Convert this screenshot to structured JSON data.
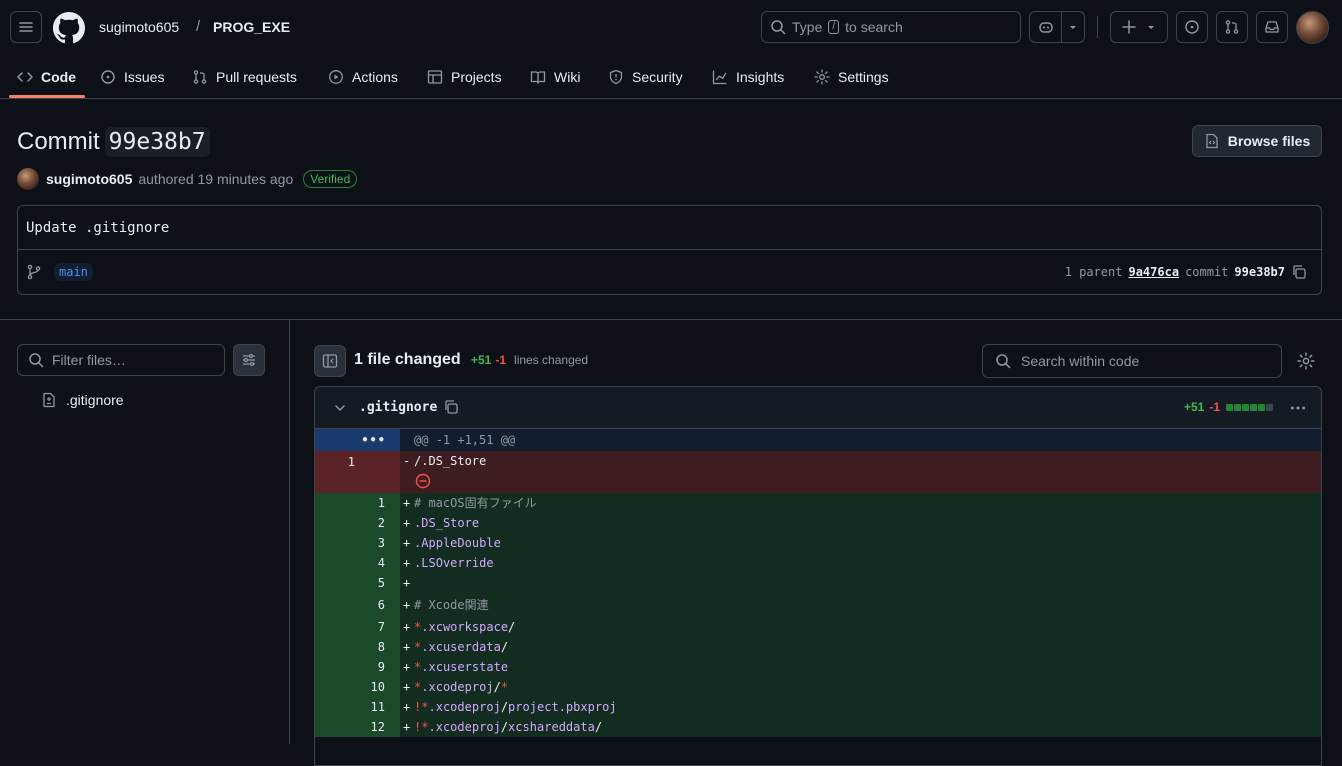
{
  "header": {
    "owner": "sugimoto605",
    "separator": "/",
    "repo": "PROG_EXE",
    "search_prefix": "Type",
    "search_key": "/",
    "search_suffix": "to search"
  },
  "nav": {
    "code": "Code",
    "issues": "Issues",
    "pulls": "Pull requests",
    "actions": "Actions",
    "projects": "Projects",
    "wiki": "Wiki",
    "security": "Security",
    "insights": "Insights",
    "settings": "Settings"
  },
  "commit": {
    "title_prefix": "Commit",
    "sha_short": "99e38b7",
    "browse_label": "Browse files",
    "author": "sugimoto605",
    "authored_text": "authored 19 minutes ago",
    "verified": "Verified",
    "message": "Update .gitignore",
    "branch": "main",
    "parent_count_text": "1 parent",
    "parent_sha": "9a476ca",
    "commit_label": "commit",
    "commit_sha": "99e38b7"
  },
  "sidebar": {
    "filter_placeholder": "Filter files…",
    "files": [
      ".gitignore"
    ]
  },
  "diff_toolbar": {
    "files_changed": "1 file changed",
    "additions": "+51",
    "deletions": "-1",
    "lines_changed_label": "lines changed",
    "search_placeholder": "Search within code"
  },
  "file": {
    "name": ".gitignore",
    "additions": "+51",
    "deletions": "-1",
    "stat_blocks": [
      "green",
      "green",
      "green",
      "green",
      "green",
      "gray"
    ],
    "colors": {
      "green": "#238636",
      "gray": "#3d444d"
    },
    "hunk_header": "@@ -1 +1,51 @@",
    "expand_glyph": "•••",
    "deleted_line": {
      "num": "1",
      "sign": "-",
      "text": "/.DS_Store"
    },
    "added_lines": [
      {
        "num": "1",
        "text": "# macOS固有ファイル"
      },
      {
        "num": "2",
        "text": ".DS_Store"
      },
      {
        "num": "3",
        "text": ".AppleDouble"
      },
      {
        "num": "4",
        "text": ".LSOverride"
      },
      {
        "num": "5",
        "text": ""
      },
      {
        "num": "6",
        "text": "# Xcode関連"
      },
      {
        "num": "7",
        "text": "*.xcworkspace/"
      },
      {
        "num": "8",
        "text": "*.xcuserdata/"
      },
      {
        "num": "9",
        "text": "*.xcuserstate"
      },
      {
        "num": "10",
        "text": "*.xcodeproj/*"
      },
      {
        "num": "11",
        "text": "!*.xcodeproj/project.pbxproj"
      },
      {
        "num": "12",
        "text": "!*.xcodeproj/xcshareddata/"
      }
    ]
  }
}
